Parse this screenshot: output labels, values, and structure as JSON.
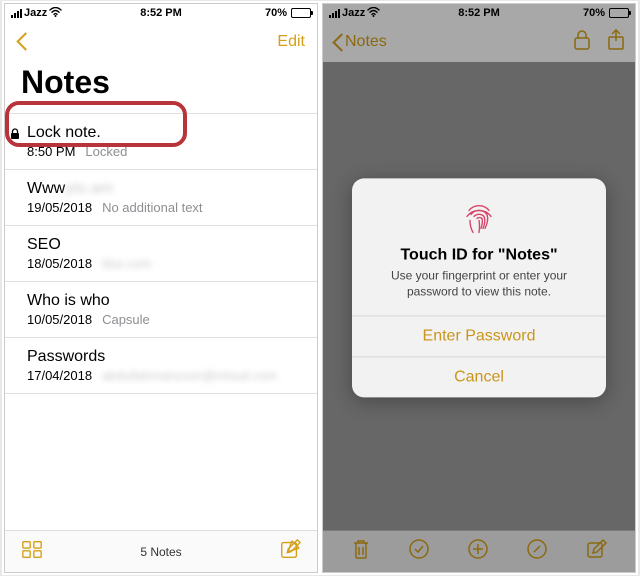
{
  "status": {
    "carrier": "Jazz",
    "time": "8:52 PM",
    "battery_pct": "70%"
  },
  "left": {
    "nav": {
      "edit": "Edit"
    },
    "title": "Notes",
    "rows": [
      {
        "title": "Lock note.",
        "date": "8:50 PM",
        "subtitle": "Locked",
        "locked": true
      },
      {
        "title": "Www",
        "date": "19/05/2018",
        "subtitle": "No additional text"
      },
      {
        "title": "SEO",
        "date": "18/05/2018",
        "subtitle": ""
      },
      {
        "title": "Who is who",
        "date": "10/05/2018",
        "subtitle": "Capsule"
      },
      {
        "title": "Passwords",
        "date": "17/04/2018",
        "subtitle": ""
      }
    ],
    "footer_count": "5 Notes"
  },
  "right": {
    "back_label": "Notes",
    "alert": {
      "title": "Touch ID for \"Notes\"",
      "message": "Use your fingerprint or enter your password to view this note.",
      "enter": "Enter Password",
      "cancel": "Cancel"
    }
  }
}
